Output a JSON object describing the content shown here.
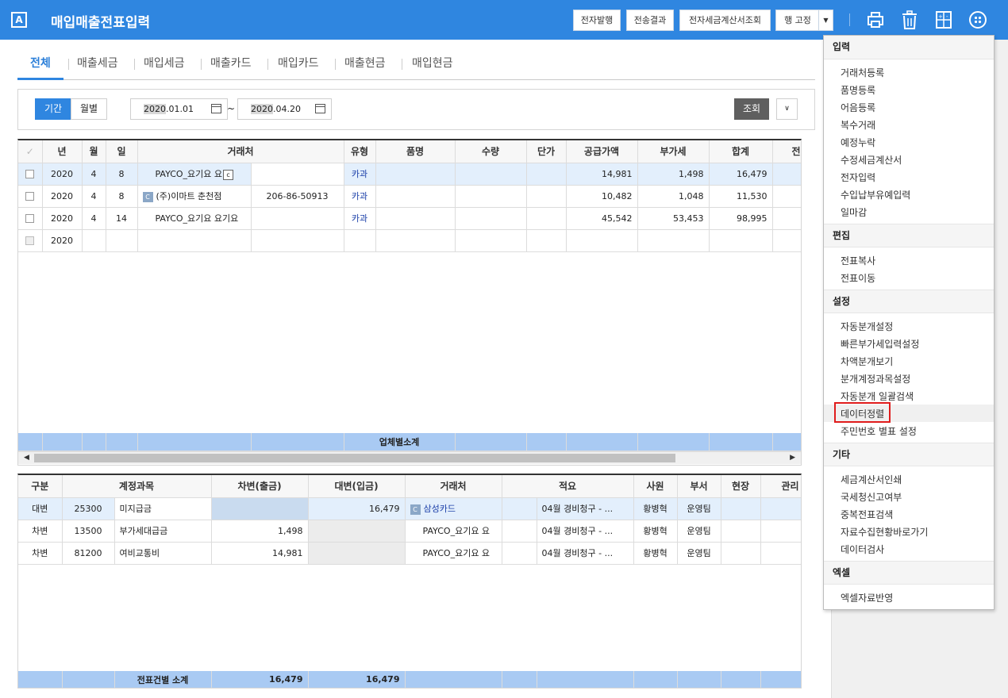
{
  "app": {
    "logo": "A",
    "title": "매입매출전표입력"
  },
  "header_buttons": {
    "e_issue": "전자발행",
    "send_result": "전송결과",
    "e_tax_query": "전자세금계산서조회",
    "row_fix": "행 고정"
  },
  "tabs": [
    "전체",
    "매출세금",
    "매입세금",
    "매출카드",
    "매입카드",
    "매출현금",
    "매입현금"
  ],
  "filter": {
    "period": "기간",
    "monthly": "월별",
    "date_from_year": "2020",
    "date_from_rest": ".01.01",
    "tilde": "~",
    "date_to_year": "2020",
    "date_to_rest": ".04.20",
    "search": "조회"
  },
  "top_table": {
    "headers": [
      "년",
      "월",
      "일",
      "거래처",
      "유형",
      "품명",
      "수량",
      "단가",
      "공급가액",
      "부가세",
      "합계",
      "전"
    ],
    "rows": [
      {
        "year": "2020",
        "month": "4",
        "day": "8",
        "vendor": "PAYCO_요기요 요",
        "code": "",
        "type": "카과",
        "supply": "14,981",
        "vat": "1,498",
        "total": "16,479"
      },
      {
        "year": "2020",
        "month": "4",
        "day": "8",
        "vendor": "(주)이마트 춘천점",
        "code": "206-86-50913",
        "type": "카과",
        "supply": "10,482",
        "vat": "1,048",
        "total": "11,530"
      },
      {
        "year": "2020",
        "month": "4",
        "day": "14",
        "vendor": "PAYCO_요기요 요기요",
        "code": "",
        "type": "카과",
        "supply": "45,542",
        "vat": "53,453",
        "total": "98,995"
      },
      {
        "year": "2020",
        "month": "",
        "day": "",
        "vendor": "",
        "code": "",
        "type": "",
        "supply": "",
        "vat": "",
        "total": ""
      }
    ],
    "subtotal_label": "업체별소계"
  },
  "bottom_table": {
    "headers": [
      "구분",
      "계정과목",
      "차변(출금)",
      "대변(입금)",
      "거래처",
      "적요",
      "사원",
      "부서",
      "현장",
      "관리"
    ],
    "rows": [
      {
        "div": "대변",
        "acct_code": "25300",
        "acct": "미지급금",
        "debit": "",
        "credit": "16,479",
        "vendor": "삼성카드",
        "memo": "04월 경비청구 - ...",
        "emp": "황병혁",
        "dept": "운영팀"
      },
      {
        "div": "차변",
        "acct_code": "13500",
        "acct": "부가세대급금",
        "debit": "1,498",
        "credit": "",
        "vendor": "PAYCO_요기요 요",
        "memo": "04월 경비청구 - ...",
        "emp": "황병혁",
        "dept": "운영팀"
      },
      {
        "div": "차변",
        "acct_code": "81200",
        "acct": "여비교통비",
        "debit": "14,981",
        "credit": "",
        "vendor": "PAYCO_요기요 요",
        "memo": "04월 경비청구 - ...",
        "emp": "황병혁",
        "dept": "운영팀"
      }
    ],
    "subtotal_label": "전표건별 소계",
    "sum_debit": "16,479",
    "sum_credit": "16,479"
  },
  "menu": {
    "sec_input": "입력",
    "input_items": [
      "거래처등록",
      "품명등록",
      "어음등록",
      "복수거래",
      "예정누락",
      "수정세금계산서",
      "전자입력",
      "수입납부유예입력",
      "일마감"
    ],
    "sec_edit": "편집",
    "edit_items": [
      "전표복사",
      "전표이동"
    ],
    "sec_settings": "설정",
    "settings_items": [
      "자동분개설정",
      "빠른부가세입력설정",
      "차액분개보기",
      "분개계정과목설정",
      "자동분개 일괄검색",
      "데이터정렬",
      "주민번호 별표 설정"
    ],
    "sec_etc": "기타",
    "etc_items": [
      "세금계산서인쇄",
      "국세청신고여부",
      "중복전표검색",
      "자료수집현황바로가기",
      "데이터검사"
    ],
    "sec_excel": "엑셀",
    "excel_items": [
      "엑셀자료반영"
    ]
  },
  "colors": {
    "header": "#2f86e0",
    "selected_row": "#e3effc",
    "subtotal": "#a9caf3",
    "highlight": "#e01c1c"
  }
}
